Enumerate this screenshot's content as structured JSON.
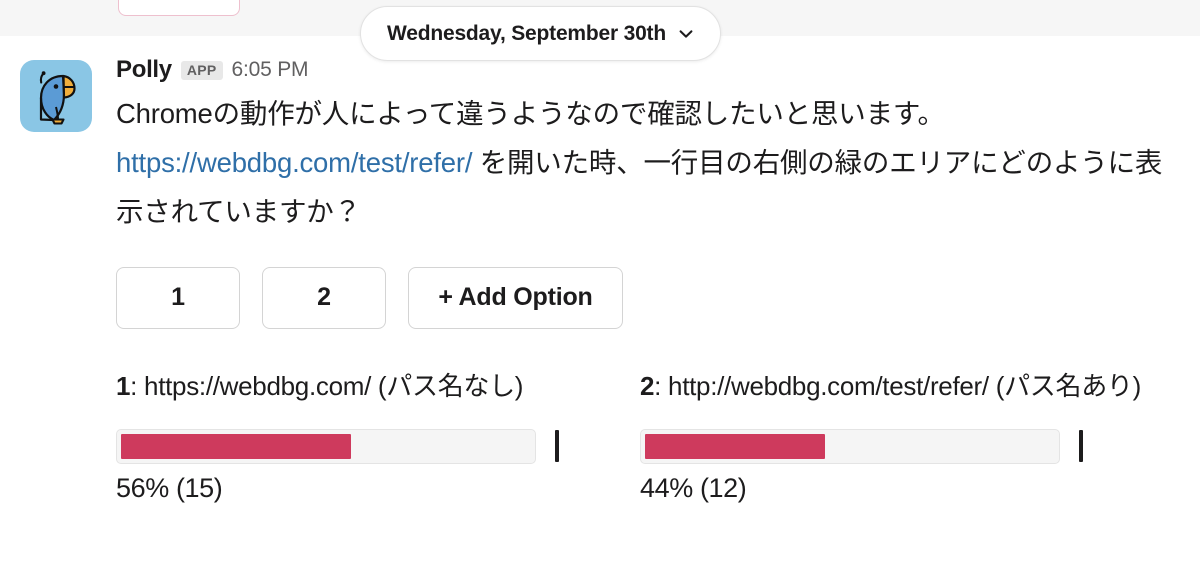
{
  "date_divider": {
    "label": "Wednesday, September 30th",
    "chevron_icon": "chevron-down-icon"
  },
  "message": {
    "avatar_icon": "polly-parrot-avatar-icon",
    "sender": "Polly",
    "app_badge": "APP",
    "timestamp": "6:05 PM",
    "text_before_link": "Chromeの動作が人によって違うようなので確認したいと思います。",
    "link_text": "https://webdbg.com/test/refer/",
    "text_after_link": " を開いた時、一行目の右側の緑のエリアにどのように表示されていますか？",
    "link_color": "#2f6fa8"
  },
  "poll": {
    "buttons": [
      {
        "label": "1",
        "name": "vote-option-1-button"
      },
      {
        "label": "2",
        "name": "vote-option-2-button"
      },
      {
        "label": "+ Add Option",
        "name": "add-option-button"
      }
    ],
    "bar_color": "#ce3a5d",
    "track_color": "#f5f5f5",
    "results": [
      {
        "number": "1",
        "separator": ": ",
        "text": "https://webdbg.com/ (パス名なし)",
        "percent": 56,
        "votes": 15,
        "percent_label": "56% (15)"
      },
      {
        "number": "2",
        "separator": ": ",
        "text": "http://webdbg.com/test/refer/ (パス名あり)",
        "percent": 44,
        "votes": 12,
        "percent_label": "44% (12)"
      }
    ]
  }
}
